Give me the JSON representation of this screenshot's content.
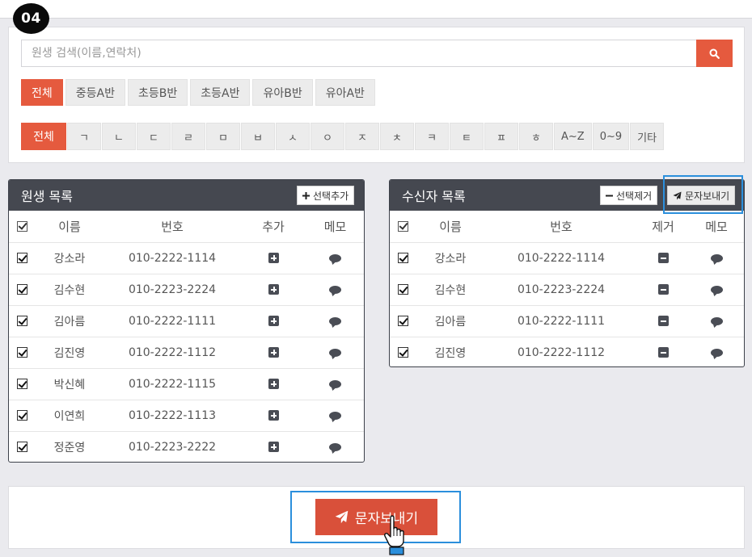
{
  "step_badge": "04",
  "search": {
    "placeholder": "원생 검색(이름,연락처)"
  },
  "class_filters": [
    "전체",
    "중등A반",
    "초등B반",
    "초등A반",
    "유아B반",
    "유아A반"
  ],
  "consonant_filters": [
    "전체",
    "ㄱ",
    "ㄴ",
    "ㄷ",
    "ㄹ",
    "ㅁ",
    "ㅂ",
    "ㅅ",
    "ㅇ",
    "ㅈ",
    "ㅊ",
    "ㅋ",
    "ㅌ",
    "ㅍ",
    "ㅎ",
    "A~Z",
    "0~9",
    "기타"
  ],
  "student_list": {
    "title": "원생 목록",
    "add_selected_label": "선택추가",
    "columns": {
      "name": "이름",
      "number": "번호",
      "action": "추가",
      "memo": "메모"
    },
    "rows": [
      {
        "name": "강소라",
        "number": "010-2222-1114"
      },
      {
        "name": "김수현",
        "number": "010-2223-2224"
      },
      {
        "name": "김아름",
        "number": "010-2222-1111"
      },
      {
        "name": "김진영",
        "number": "010-2222-1112"
      },
      {
        "name": "박신혜",
        "number": "010-2222-1115"
      },
      {
        "name": "이연희",
        "number": "010-2222-1113"
      },
      {
        "name": "정준영",
        "number": "010-2223-2222"
      }
    ]
  },
  "recipient_list": {
    "title": "수신자 목록",
    "remove_selected_label": "선택제거",
    "send_label": "문자보내기",
    "columns": {
      "name": "이름",
      "number": "번호",
      "action": "제거",
      "memo": "메모"
    },
    "rows": [
      {
        "name": "강소라",
        "number": "010-2222-1114"
      },
      {
        "name": "김수현",
        "number": "010-2223-2224"
      },
      {
        "name": "김아름",
        "number": "010-2222-1111"
      },
      {
        "name": "김진영",
        "number": "010-2222-1112"
      }
    ]
  },
  "bottom": {
    "send_label": "문자보내기"
  },
  "colors": {
    "accent": "#e55a3e",
    "panel_header": "#454850",
    "highlight": "#2b8fdc"
  }
}
